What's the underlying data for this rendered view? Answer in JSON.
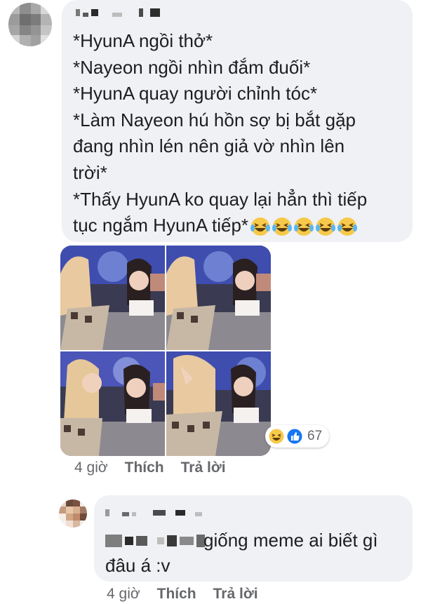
{
  "comment_1": {
    "lines": [
      "*HyunA ngồi thở*",
      "*Nayeon ngồi nhìn đắm đuối*",
      "*HyunA quay người chỉnh tóc*",
      "*Làm Nayeon hú hồn sợ bị bắt gặp",
      "đang nhìn lén nên giả vờ nhìn lên",
      "trời*",
      "*Thấy HyunA ko quay lại hẳn thì tiếp",
      "tục ngắm HyunA tiếp*"
    ],
    "emoji": [
      "laughing-tears",
      "laughing-tears",
      "laughing-tears",
      "laughing-tears",
      "laughing-tears"
    ],
    "reaction_count": "67",
    "time": "4 giờ",
    "like_label": "Thích",
    "reply_label": "Trả lời"
  },
  "reply_1": {
    "lines": [
      "giống meme ai biết gì",
      "đâu á :v"
    ],
    "time": "4 giờ",
    "like_label": "Thích",
    "reply_label": "Trả lời"
  },
  "colors": {
    "bubble": "#eff1f4",
    "meta_text": "#65676b",
    "like_blue": "#1877f2",
    "haha_yellow": "#f7c94a"
  }
}
